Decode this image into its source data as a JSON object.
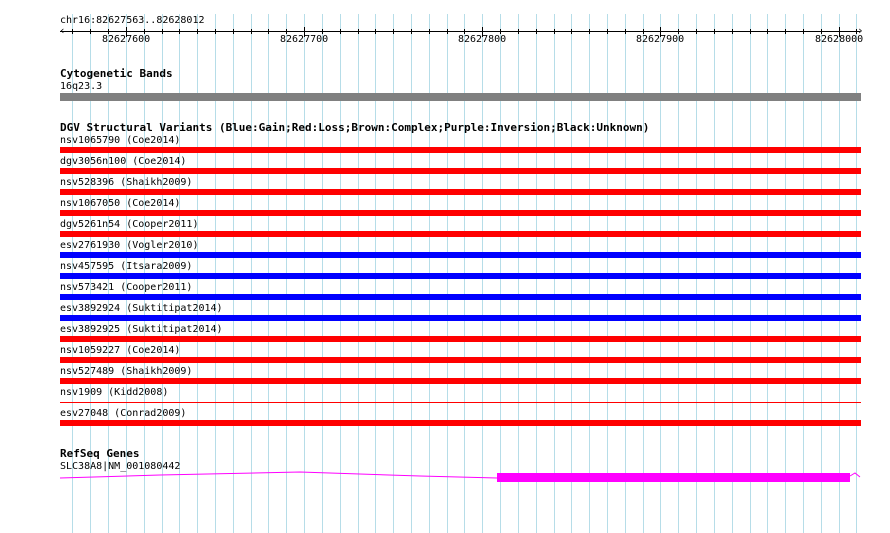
{
  "ruler": {
    "location": "chr16:82627563..82628012",
    "start": 82627563,
    "end": 82628012,
    "tick_labels": [
      "82627600",
      "82627700",
      "82627800",
      "82627900",
      "82628000"
    ]
  },
  "tracks": {
    "cytogenetic": {
      "title": "Cytogenetic Bands",
      "band_label": "16q23.3",
      "color": "#808080"
    },
    "dgv": {
      "title": "DGV Structural Variants (Blue:Gain;Red:Loss;Brown:Complex;Purple:Inversion;Black:Unknown)",
      "colors": {
        "loss": "#ff0000",
        "gain": "#0000ff"
      },
      "variants": [
        {
          "label": "nsv1065790 (Coe2014)",
          "type": "loss"
        },
        {
          "label": "dgv3056n100 (Coe2014)",
          "type": "loss"
        },
        {
          "label": "nsv528396 (Shaikh2009)",
          "type": "loss"
        },
        {
          "label": "nsv1067050 (Coe2014)",
          "type": "loss"
        },
        {
          "label": "dgv5261n54 (Cooper2011)",
          "type": "loss"
        },
        {
          "label": "esv2761930 (Vogler2010)",
          "type": "gain"
        },
        {
          "label": "nsv457595 (Itsara2009)",
          "type": "gain"
        },
        {
          "label": "nsv573421 (Cooper2011)",
          "type": "gain"
        },
        {
          "label": "esv3892924 (Suktitipat2014)",
          "type": "gain"
        },
        {
          "label": "esv3892925 (Suktitipat2014)",
          "type": "loss"
        },
        {
          "label": "nsv1059227 (Coe2014)",
          "type": "loss"
        },
        {
          "label": "nsv527489 (Shaikh2009)",
          "type": "loss"
        },
        {
          "label": "nsv1909 (Kidd2008)",
          "type": "loss",
          "thin": true
        },
        {
          "label": "esv27048 (Conrad2009)",
          "type": "loss"
        }
      ]
    },
    "refseq": {
      "title": "RefSeq Genes",
      "gene_label": "SLC38A8|NM_001080442",
      "color": "#ff00ff"
    }
  }
}
